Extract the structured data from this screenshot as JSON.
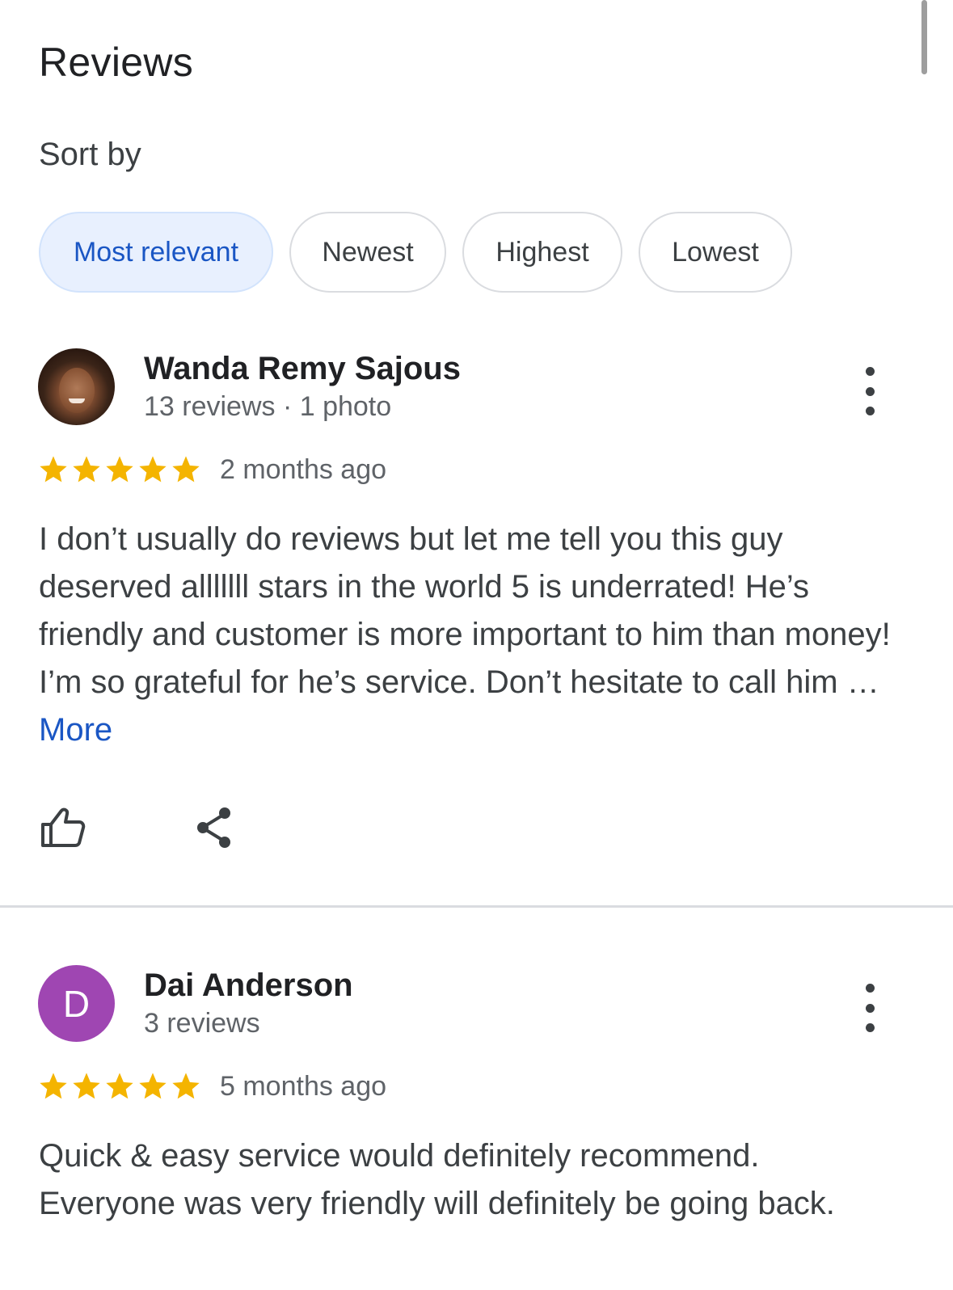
{
  "page": {
    "title": "Reviews",
    "sort_label": "Sort by"
  },
  "sort_options": [
    {
      "label": "Most relevant",
      "selected": true
    },
    {
      "label": "Newest",
      "selected": false
    },
    {
      "label": "Highest",
      "selected": false
    },
    {
      "label": "Lowest",
      "selected": false
    }
  ],
  "colors": {
    "accent_blue": "#1a56c4",
    "star_yellow": "#f4b400",
    "selected_chip_bg": "#e8f0fe",
    "letter_avatar_purple": "#9f46b2"
  },
  "reviews": [
    {
      "author": "Wanda Remy Sajous",
      "meta": "13 reviews · 1 photo",
      "avatar": "photo",
      "rating": 5,
      "date": "2 months ago",
      "text": "I don’t usually do reviews but let me tell you this guy deserved alllllll stars in the world 5 is underrated! He’s friendly and customer is more important to him than money! I’m so grateful for he’s service. Don’t hesitate to call him … ",
      "more_label": "More"
    },
    {
      "author": "Dai Anderson",
      "meta": "3 reviews",
      "avatar_letter": "D",
      "rating": 5,
      "date": "5 months ago",
      "text": "Quick & easy service would definitely recommend. Everyone was very friendly will definitely be going back."
    }
  ],
  "icons": {
    "like": "thumbs-up-icon",
    "share": "share-icon",
    "menu": "more-vertical-icon",
    "star": "star-icon"
  }
}
